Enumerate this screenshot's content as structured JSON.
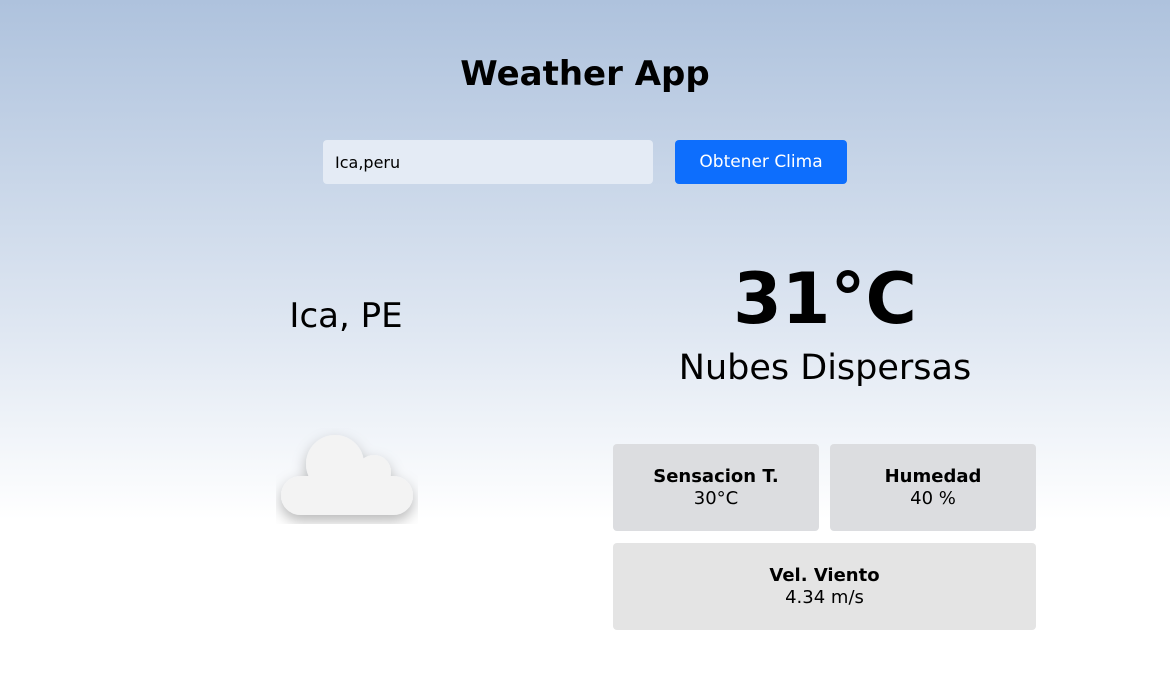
{
  "header": {
    "title": "Weather App"
  },
  "search": {
    "value": "Ica,peru",
    "button_label": "Obtener Clima"
  },
  "location": {
    "city": "Ica, PE"
  },
  "weather": {
    "temperature": "31°C",
    "description": "Nubes Dispersas",
    "icon": "cloud-icon"
  },
  "details": {
    "feels_like": {
      "label": "Sensacion T.",
      "value": "30°C"
    },
    "humidity": {
      "label": "Humedad",
      "value": "40 %"
    },
    "wind": {
      "label": "Vel. Viento",
      "value": "4.34 m/s"
    }
  },
  "colors": {
    "button": "#0d6efd",
    "background_top": "#aec2dd",
    "card": "#e3e4e6"
  }
}
